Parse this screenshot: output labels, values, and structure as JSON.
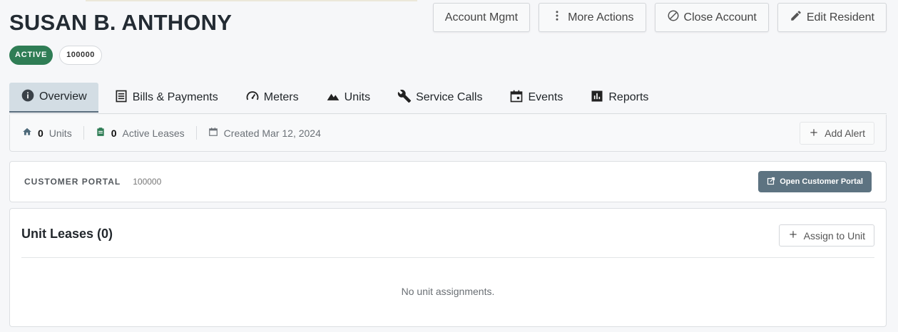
{
  "resident": {
    "name": "SUSAN B. ANTHONY",
    "status": "ACTIVE",
    "account_id": "100000"
  },
  "actions": {
    "account_mgmt": "Account Mgmt",
    "more_actions": "More Actions",
    "close_account": "Close Account",
    "edit_resident": "Edit Resident"
  },
  "tabs": [
    {
      "label": "Overview",
      "icon": "info-icon",
      "active": true
    },
    {
      "label": "Bills & Payments",
      "icon": "receipt-icon"
    },
    {
      "label": "Meters",
      "icon": "gauge-icon"
    },
    {
      "label": "Units",
      "icon": "terrain-icon"
    },
    {
      "label": "Service Calls",
      "icon": "wrench-icon"
    },
    {
      "label": "Events",
      "icon": "calendar-icon"
    },
    {
      "label": "Reports",
      "icon": "bar-chart-icon"
    }
  ],
  "stats": {
    "units_count": "0",
    "units_label": "Units",
    "leases_count": "0",
    "leases_label": "Active Leases",
    "created": "Created Mar 12, 2024",
    "add_alert": "Add Alert"
  },
  "portal": {
    "label": "CUSTOMER PORTAL",
    "id": "100000",
    "button": "Open Customer Portal"
  },
  "leases": {
    "title": "Unit Leases (0)",
    "assign": "Assign to Unit",
    "empty": "No unit assignments."
  },
  "colors": {
    "active_badge": "#2f7d55",
    "active_tab_bg": "#d3dde4",
    "portal_button": "#5d7381"
  }
}
